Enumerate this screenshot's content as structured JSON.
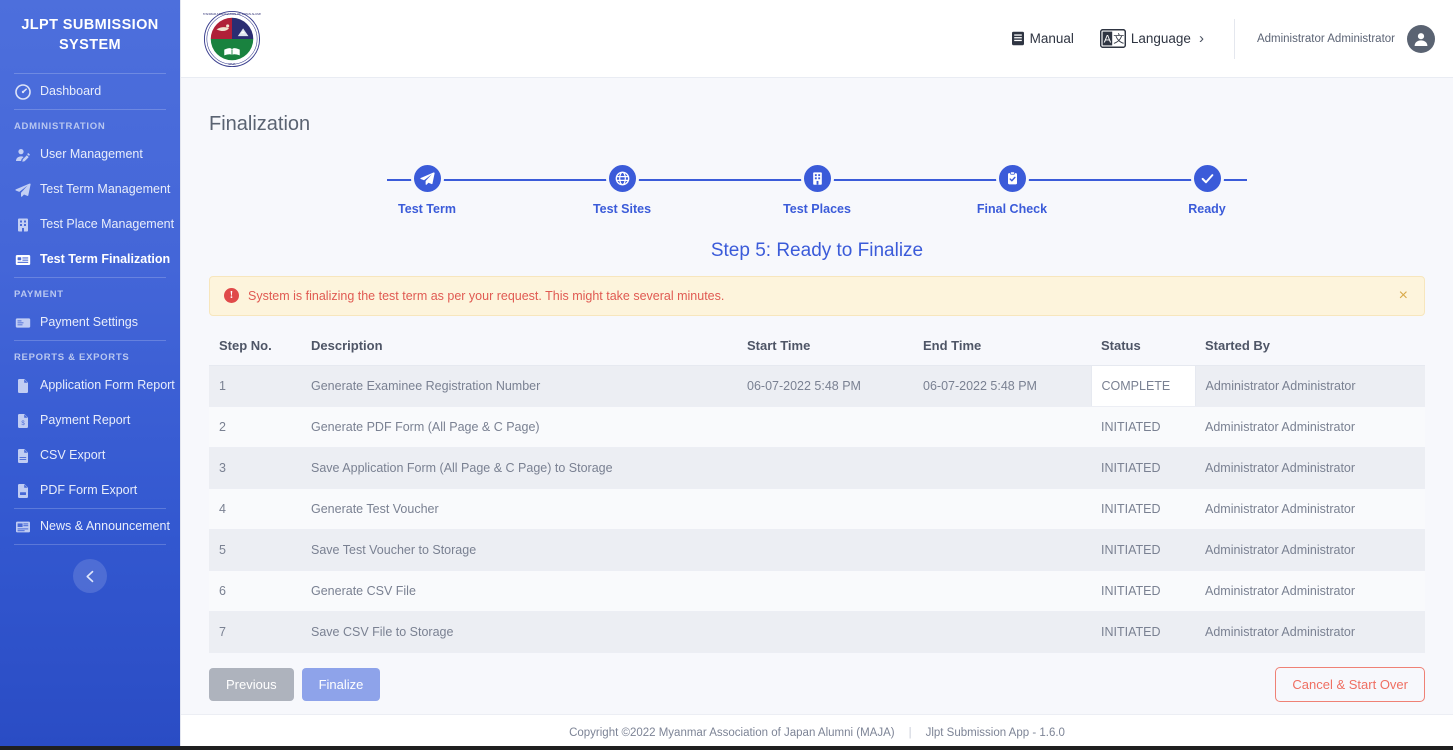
{
  "sidebar": {
    "brand_title": "JLPT SUBMISSION SYSTEM",
    "items": [
      {
        "label": "Dashboard",
        "icon": "dashboard-icon"
      },
      {
        "label": "User Management",
        "icon": "user-edit-icon"
      },
      {
        "label": "Test Term Management",
        "icon": "paper-plane-icon"
      },
      {
        "label": "Test Place Management",
        "icon": "building-icon"
      },
      {
        "label": "Test Term Finalization",
        "icon": "id-card-icon"
      },
      {
        "label": "Payment Settings",
        "icon": "card-icon"
      },
      {
        "label": "Application Form Report",
        "icon": "file-icon"
      },
      {
        "label": "Payment Report",
        "icon": "file-invoice-icon"
      },
      {
        "label": "CSV Export",
        "icon": "file-csv-icon"
      },
      {
        "label": "PDF Form Export",
        "icon": "file-pdf-icon"
      },
      {
        "label": "News & Announcement",
        "icon": "newspaper-icon"
      }
    ],
    "sections": {
      "administration": "ADMINISTRATION",
      "payment": "PAYMENT",
      "reports": "REPORTS & EXPORTS"
    },
    "collapse_label": "collapse-sidebar"
  },
  "topbar": {
    "manual_label": "Manual",
    "language_label": "Language",
    "language_chevron": "›",
    "user_name": "Administrator Administrator"
  },
  "main": {
    "page_title": "Finalization",
    "step_heading": "Step 5: Ready to Finalize",
    "stepper": [
      {
        "label": "Test Term",
        "icon": "paper-plane-icon"
      },
      {
        "label": "Test Sites",
        "icon": "globe-icon"
      },
      {
        "label": "Test Places",
        "icon": "building-icon"
      },
      {
        "label": "Final Check",
        "icon": "clipboard-check-icon"
      },
      {
        "label": "Ready",
        "icon": "check-icon"
      }
    ],
    "alert": {
      "icon_text": "!",
      "message": "System is finalizing the test term as per your request. This might take several minutes.",
      "close_label": "×"
    },
    "table": {
      "headers": [
        "Step No.",
        "Description",
        "Start Time",
        "End Time",
        "Status",
        "Started By"
      ],
      "rows": [
        {
          "no": "1",
          "desc": "Generate Examinee Registration Number",
          "start": "06-07-2022 5:48 PM",
          "end": "06-07-2022 5:48 PM",
          "status": "COMPLETE",
          "by": "Administrator Administrator"
        },
        {
          "no": "2",
          "desc": "Generate PDF Form (All Page & C Page)",
          "start": "",
          "end": "",
          "status": "INITIATED",
          "by": "Administrator Administrator"
        },
        {
          "no": "3",
          "desc": "Save Application Form (All Page & C Page) to Storage",
          "start": "",
          "end": "",
          "status": "INITIATED",
          "by": "Administrator Administrator"
        },
        {
          "no": "4",
          "desc": "Generate Test Voucher",
          "start": "",
          "end": "",
          "status": "INITIATED",
          "by": "Administrator Administrator"
        },
        {
          "no": "5",
          "desc": "Save Test Voucher to Storage",
          "start": "",
          "end": "",
          "status": "INITIATED",
          "by": "Administrator Administrator"
        },
        {
          "no": "6",
          "desc": "Generate CSV File",
          "start": "",
          "end": "",
          "status": "INITIATED",
          "by": "Administrator Administrator"
        },
        {
          "no": "7",
          "desc": "Save CSV File to Storage",
          "start": "",
          "end": "",
          "status": "INITIATED",
          "by": "Administrator Administrator"
        }
      ]
    },
    "actions": {
      "previous": "Previous",
      "finalize": "Finalize",
      "cancel": "Cancel & Start Over"
    }
  },
  "footer": {
    "copyright": "Copyright ©2022 Myanmar Association of Japan Alumni (MAJA)",
    "separator": "|",
    "version": "Jlpt Submission App - 1.6.0"
  },
  "colors": {
    "sidebar_top": "#4d6fdc",
    "sidebar_bottom": "#2a4cc4",
    "accent": "#3b5bd9",
    "alert_bg": "#fdf4dc",
    "alert_text": "#e05a52",
    "danger": "#ef6f62"
  }
}
